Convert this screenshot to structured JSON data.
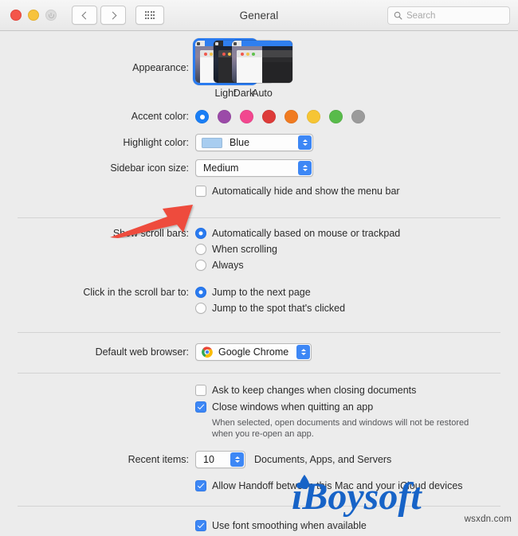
{
  "window": {
    "title": "General",
    "traffic_lights": [
      "close",
      "minimize",
      "zoom"
    ],
    "nav": {
      "back": "back-button",
      "forward": "forward-button",
      "grid": "show-all-button"
    },
    "search": {
      "placeholder": "Search",
      "value": ""
    }
  },
  "appearance": {
    "label": "Appearance:",
    "options": [
      {
        "name": "Light",
        "selected": true
      },
      {
        "name": "Dark",
        "selected": false
      },
      {
        "name": "Auto",
        "selected": false
      }
    ]
  },
  "accent_color": {
    "label": "Accent color:",
    "selected_index": 0,
    "swatches": [
      {
        "name": "blue",
        "hex": "#1a7ef5"
      },
      {
        "name": "purple",
        "hex": "#9b4aa8"
      },
      {
        "name": "pink",
        "hex": "#f2478f"
      },
      {
        "name": "red",
        "hex": "#dd3b39"
      },
      {
        "name": "orange",
        "hex": "#f07b21"
      },
      {
        "name": "yellow",
        "hex": "#f6c534"
      },
      {
        "name": "green",
        "hex": "#58bb4a"
      },
      {
        "name": "graphite",
        "hex": "#9b9b9b"
      }
    ]
  },
  "highlight_color": {
    "label": "Highlight color:",
    "value": "Blue",
    "swatch_hex": "#a8cdf0"
  },
  "sidebar_icon_size": {
    "label": "Sidebar icon size:",
    "value": "Medium"
  },
  "menu_bar": {
    "auto_hide": {
      "label": "Automatically hide and show the menu bar",
      "checked": false
    }
  },
  "scroll_bars": {
    "label": "Show scroll bars:",
    "options": [
      {
        "label": "Automatically based on mouse or trackpad",
        "selected": true
      },
      {
        "label": "When scrolling",
        "selected": false
      },
      {
        "label": "Always",
        "selected": false
      }
    ]
  },
  "scroll_click": {
    "label": "Click in the scroll bar to:",
    "options": [
      {
        "label": "Jump to the next page",
        "selected": true
      },
      {
        "label": "Jump to the spot that's clicked",
        "selected": false
      }
    ]
  },
  "default_browser": {
    "label": "Default web browser:",
    "value": "Google Chrome"
  },
  "documents": {
    "ask_keep_changes": {
      "label": "Ask to keep changes when closing documents",
      "checked": false
    },
    "close_windows": {
      "label": "Close windows when quitting an app",
      "checked": true
    },
    "close_windows_help_line1": "When selected, open documents and windows will not be restored",
    "close_windows_help_line2": "when you re-open an app."
  },
  "recent_items": {
    "label": "Recent items:",
    "value": "10",
    "suffix": "Documents, Apps, and Servers"
  },
  "handoff": {
    "label": "Allow Handoff between this Mac and your iCloud devices",
    "checked": true
  },
  "font_smoothing": {
    "label": "Use font smoothing when available",
    "checked": true
  },
  "annotation": {
    "arrow_color": "#ee4b3c",
    "points_to": "auto-hide-menu-bar-checkbox"
  },
  "watermark": {
    "brand": "iBoysoft",
    "domain": "wsxdn.com",
    "brand_color": "#1763c7"
  }
}
